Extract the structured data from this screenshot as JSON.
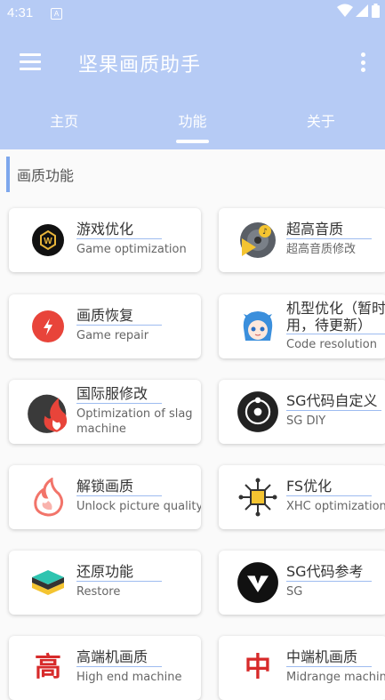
{
  "status": {
    "time": "4:31",
    "indicator": "A"
  },
  "appbar": {
    "title": "坚果画质助手"
  },
  "tabs": [
    {
      "label": "主页"
    },
    {
      "label": "功能"
    },
    {
      "label": "关于"
    }
  ],
  "section": {
    "title": "画质功能"
  },
  "cards": [
    {
      "title": "游戏优化",
      "subtitle": "Game optimization",
      "icon": "wzry-logo-icon"
    },
    {
      "title": "超高音质",
      "subtitle": "超高音质修改",
      "icon": "music-disc-icon"
    },
    {
      "title": "画质恢复",
      "subtitle": "Game repair",
      "icon": "lightning-icon"
    },
    {
      "title": "机型优化（暂时用，待更新）",
      "subtitle": "Code resolution",
      "icon": "anime-avatar-icon"
    },
    {
      "title": "国际服修改",
      "subtitle": "Optimization of slag machine",
      "icon": "flame-circle-icon"
    },
    {
      "title": "SG代码自定义",
      "subtitle": "SG DIY",
      "icon": "orbit-icon"
    },
    {
      "title": "解锁画质",
      "subtitle": "Unlock picture quality",
      "icon": "fire-outline-icon"
    },
    {
      "title": "FS优化",
      "subtitle": "XHC optimization",
      "icon": "chip-icon"
    },
    {
      "title": "还原功能",
      "subtitle": "Restore",
      "icon": "layers-icon"
    },
    {
      "title": "SG代码参考",
      "subtitle": "SG",
      "icon": "v-logo-icon"
    },
    {
      "title": "高端机画质",
      "subtitle": "High end machine",
      "icon": "gao-char-icon",
      "glyph": "高"
    },
    {
      "title": "中端机画质",
      "subtitle": "Midrange machine",
      "icon": "zhong-char-icon",
      "glyph": "中"
    }
  ],
  "colors": {
    "appbar": "#b6cbf5",
    "accent": "#7ea7ec",
    "background": "#fafafa"
  }
}
